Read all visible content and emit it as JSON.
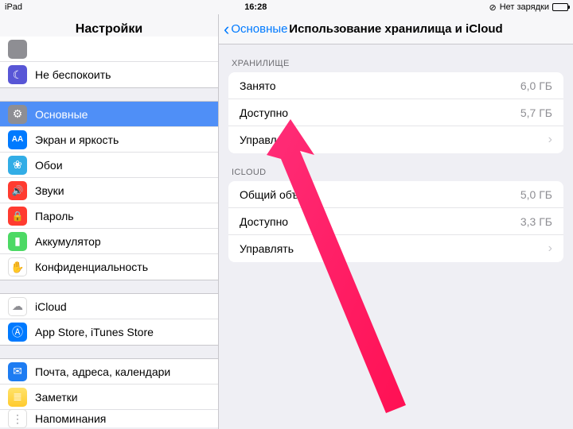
{
  "statusbar": {
    "device": "iPad",
    "time": "16:28",
    "charging": "Нет зарядки"
  },
  "sidebar": {
    "title": "Настройки",
    "g1": [
      {
        "label": "",
        "icon": "gray"
      },
      {
        "label": "Не беспокоить",
        "icon": "purple"
      }
    ],
    "g2": [
      {
        "label": "Основные",
        "icon": "gray",
        "selected": true
      },
      {
        "label": "Экран и яркость",
        "icon": "blue"
      },
      {
        "label": "Обои",
        "icon": "cyan"
      },
      {
        "label": "Звуки",
        "icon": "red"
      },
      {
        "label": "Пароль",
        "icon": "red"
      },
      {
        "label": "Аккумулятор",
        "icon": "green"
      },
      {
        "label": "Конфиденциальность",
        "icon": "white"
      }
    ],
    "g3": [
      {
        "label": "iCloud",
        "icon": "white"
      },
      {
        "label": "App Store, iTunes Store",
        "icon": "blue"
      }
    ],
    "g4": [
      {
        "label": "Почта, адреса, календари",
        "icon": "mail"
      },
      {
        "label": "Заметки",
        "icon": "notes"
      },
      {
        "label": "Напоминания",
        "icon": "white"
      }
    ]
  },
  "detail": {
    "back": "Основные",
    "title": "Использование хранилища и iCloud",
    "sections": [
      {
        "header": "ХРАНИЛИЩЕ",
        "rows": [
          {
            "label": "Занято",
            "value": "6,0 ГБ"
          },
          {
            "label": "Доступно",
            "value": "5,7 ГБ"
          },
          {
            "label": "Управлять",
            "chevron": true
          }
        ]
      },
      {
        "header": "ICLOUD",
        "rows": [
          {
            "label": "Общий объём",
            "value": "5,0 ГБ"
          },
          {
            "label": "Доступно",
            "value": "3,3 ГБ"
          },
          {
            "label": "Управлять",
            "chevron": true
          }
        ]
      }
    ]
  },
  "icons": {
    "gear": "⚙",
    "moon": "☾",
    "aa": "AA",
    "flower": "❀",
    "speaker": "🔊",
    "lock": "🔒",
    "battery": "▮",
    "hand": "✋",
    "cloud": "☁",
    "appstore": "Ⓐ",
    "mail": "✉",
    "notes": "≣",
    "reminders": "⋮"
  }
}
